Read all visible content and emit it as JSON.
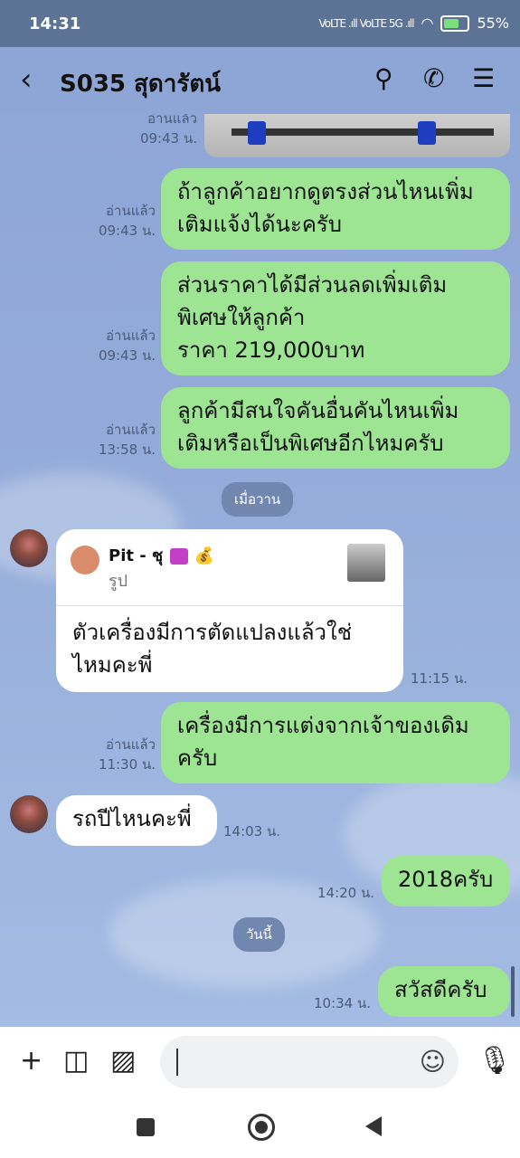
{
  "status_bar": {
    "time": "14:31",
    "network": "VoLTE .ıll VoLTE 5G .ıll",
    "battery": "55%"
  },
  "header": {
    "title": "S035 สุดารัตน์",
    "icons": [
      "back-icon",
      "search-icon",
      "phone-icon",
      "menu-icon"
    ]
  },
  "messages": [
    {
      "dir": "out",
      "read": "อ่านแล้ว",
      "time": "09:43 น.",
      "type": "image"
    },
    {
      "dir": "out",
      "read": "อ่านแล้ว",
      "time": "09:43 น.",
      "lines": [
        "ถ้าลูกค้าอยากดูตรงส่วนไหนเพิ่ม",
        "เติมแจ้งได้นะครับ"
      ]
    },
    {
      "dir": "out",
      "read": "อ่านแล้ว",
      "time": "09:43 น.",
      "lines": [
        "ส่วนราคาได้มีส่วนลดเพิ่มเติม",
        "พิเศษให้ลูกค้า",
        "ราคา 219,000บาท"
      ]
    },
    {
      "dir": "out",
      "read": "อ่านแล้ว",
      "time": "13:58 น.",
      "lines": [
        "ลูกค้ามีสนใจคันอื่นคันไหนเพิ่ม",
        "เติมหรือเป็นพิเศษอีกไหมครับ"
      ]
    },
    {
      "dir": "in",
      "time": "11:15 น.",
      "quote": {
        "name": "Pit - ชุ",
        "sub": "รูป"
      },
      "lines": [
        "ตัวเครื่องมีการตัดแปลงแล้วใช่",
        "ไหมคะพี่"
      ]
    },
    {
      "dir": "out",
      "read": "อ่านแล้ว",
      "time": "11:30 น.",
      "lines": [
        "เครื่องมีการแต่งจากเจ้าของเดิม",
        "ครับ"
      ]
    },
    {
      "dir": "in",
      "time": "14:03 น.",
      "lines": [
        "รถปีไหนคะพี่"
      ]
    },
    {
      "dir": "out",
      "time": "14:20 น.",
      "lines": [
        "2018ครับ"
      ]
    },
    {
      "dir": "out",
      "time": "10:34 น.",
      "lines": [
        "สวัสดีครับ"
      ]
    }
  ],
  "date_chips": {
    "yesterday": "เมื่อวาน",
    "today": "วันนี้"
  },
  "input": {
    "placeholder": ""
  },
  "colors": {
    "outgoing": "#9de593",
    "incoming": "#ffffff",
    "background": "#8ea6d6"
  }
}
